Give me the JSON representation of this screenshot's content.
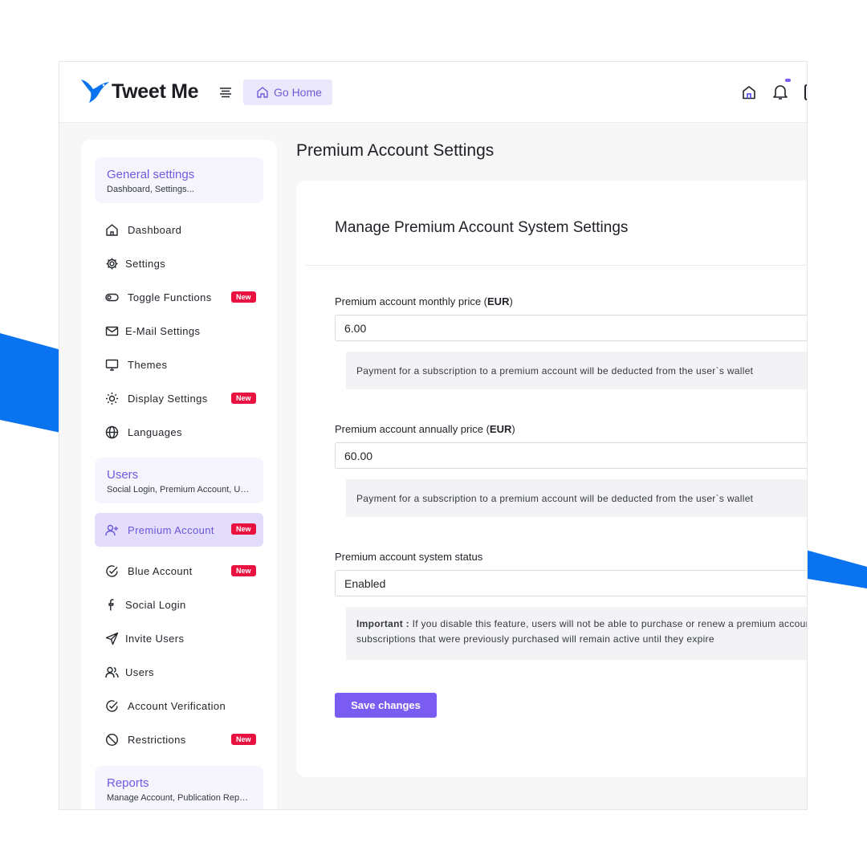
{
  "app": {
    "brand": "Tweet Me",
    "go_home_label": "Go Home"
  },
  "colors": {
    "accent": "#7b5cf2",
    "decor_blue": "#0a73f0",
    "badge_red": "#e8113f"
  },
  "sidebar": {
    "sections": [
      {
        "title": "General settings",
        "subtitle": "Dashboard, Settings...",
        "items": [
          {
            "label": "Dashboard",
            "icon": "home-icon"
          },
          {
            "label": "Settings",
            "icon": "gear-icon"
          },
          {
            "label": "Toggle Functions",
            "icon": "toggle-icon",
            "badge": "New"
          },
          {
            "label": "E-Mail Settings",
            "icon": "mail-icon"
          },
          {
            "label": "Themes",
            "icon": "monitor-icon"
          },
          {
            "label": "Display Settings",
            "icon": "sun-icon",
            "badge": "New"
          },
          {
            "label": "Languages",
            "icon": "globe-icon"
          }
        ]
      },
      {
        "title": "Users",
        "subtitle": "Social Login, Premium Account, Users...",
        "items": [
          {
            "label": "Premium Account",
            "icon": "user-plus-icon",
            "badge": "New",
            "active": true
          },
          {
            "label": "Blue Account",
            "icon": "check-circle-icon",
            "badge": "New"
          },
          {
            "label": "Social Login",
            "icon": "facebook-icon"
          },
          {
            "label": "Invite Users",
            "icon": "send-icon"
          },
          {
            "label": "Users",
            "icon": "users-icon"
          },
          {
            "label": "Account Verification",
            "icon": "check-circle-icon"
          },
          {
            "label": "Restrictions",
            "icon": "ban-icon",
            "badge": "New"
          }
        ]
      },
      {
        "title": "Reports",
        "subtitle": "Manage Account, Publication Reports..."
      }
    ]
  },
  "main": {
    "page_title": "Premium Account Settings",
    "card_title": "Manage Premium Account System Settings",
    "fields": [
      {
        "label": "Premium account monthly price (",
        "label_bold": "EUR",
        "label_end": ")",
        "value": "6.00",
        "hint": "Payment for a subscription to a premium account will be deducted from the user`s wallet"
      },
      {
        "label": "Premium account annually price (",
        "label_bold": "EUR",
        "label_end": ")",
        "value": "60.00",
        "hint": "Payment for a subscription to a premium account will be deducted from the user`s wallet"
      },
      {
        "label": "Premium account system status",
        "value": "Enabled",
        "hint_bold": "Important :",
        "hint_line1": " If you disable this feature, users will not be able to purchase or renew a premium account",
        "hint_line2": "subscriptions that were previously purchased will remain active until they expire"
      }
    ],
    "save_label": "Save changes"
  }
}
